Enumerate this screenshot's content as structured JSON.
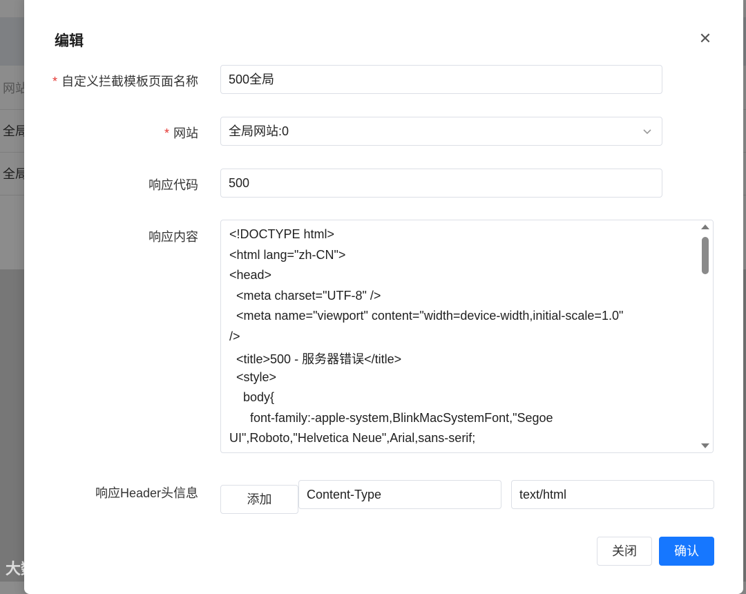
{
  "background": {
    "rows": [
      "网站",
      "全局",
      "全局"
    ]
  },
  "dialog": {
    "title": "编辑",
    "close_icon": "close-icon",
    "fields": {
      "name": {
        "label": "自定义拦截模板页面名称",
        "required": true,
        "value": "500全局"
      },
      "site": {
        "label": "网站",
        "required": true,
        "value": "全局网站:0"
      },
      "code": {
        "label": "响应代码",
        "value": "500"
      },
      "content": {
        "label": "响应内容",
        "lines": [
          "<!DOCTYPE html>",
          "<html lang=\"zh-CN\">",
          "<head>",
          "  <meta charset=\"UTF-8\" />",
          "  <meta name=\"viewport\" content=\"width=device-width,initial-scale=1.0\"",
          "/>",
          "  <title>500 - 服务器错误</title>",
          "  <style>",
          "    body{",
          "      font-family:-apple-system,BlinkMacSystemFont,\"Segoe",
          "UI\",Roboto,\"Helvetica Neue\",Arial,sans-serif;"
        ]
      },
      "headers": {
        "label": "响应Header头信息",
        "add_label": "添加",
        "key": "Content-Type",
        "value": "text/html"
      }
    },
    "footer": {
      "cancel_label": "关闭",
      "confirm_label": "确认"
    }
  },
  "watermark": "大数跨境",
  "colors": {
    "primary": "#1677ff",
    "required": "#e53935"
  }
}
